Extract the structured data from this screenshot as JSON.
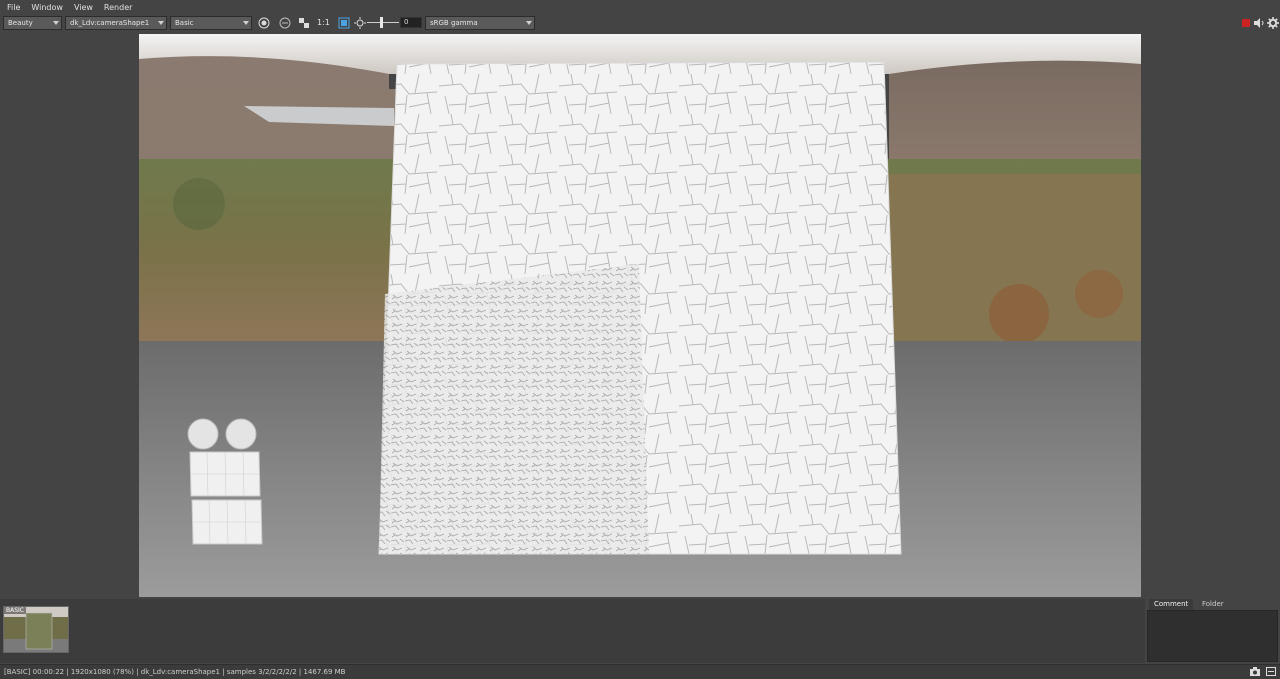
{
  "menu": [
    "File",
    "Window",
    "View",
    "Render"
  ],
  "toolbar": {
    "aov_select": "Beauty",
    "camera_select": "dk_Ldv:cameraShape1",
    "preset_select": "Basic",
    "ratio_label": "1:1",
    "exposure_value": "0",
    "color_space_select": "sRGB gamma"
  },
  "thumbnail": {
    "label": "BASIC"
  },
  "side_panel": {
    "tabs": [
      "Comment",
      "Folder"
    ]
  },
  "status": {
    "text": "[BASIC]   00:00:22 | 1920x1080 (78%) | dk_Ldv:cameraShape1  | samples 3/2/2/2/2/2 | 1467.69 MB"
  },
  "colors": {
    "chrome": "#444444",
    "stop_indicator": "#cc2222",
    "accent_icon": "#4aa3e0"
  },
  "icons": [
    "gear-icon",
    "stop-icon",
    "speaker-icon",
    "camera-icon",
    "snapshot-icon"
  ]
}
